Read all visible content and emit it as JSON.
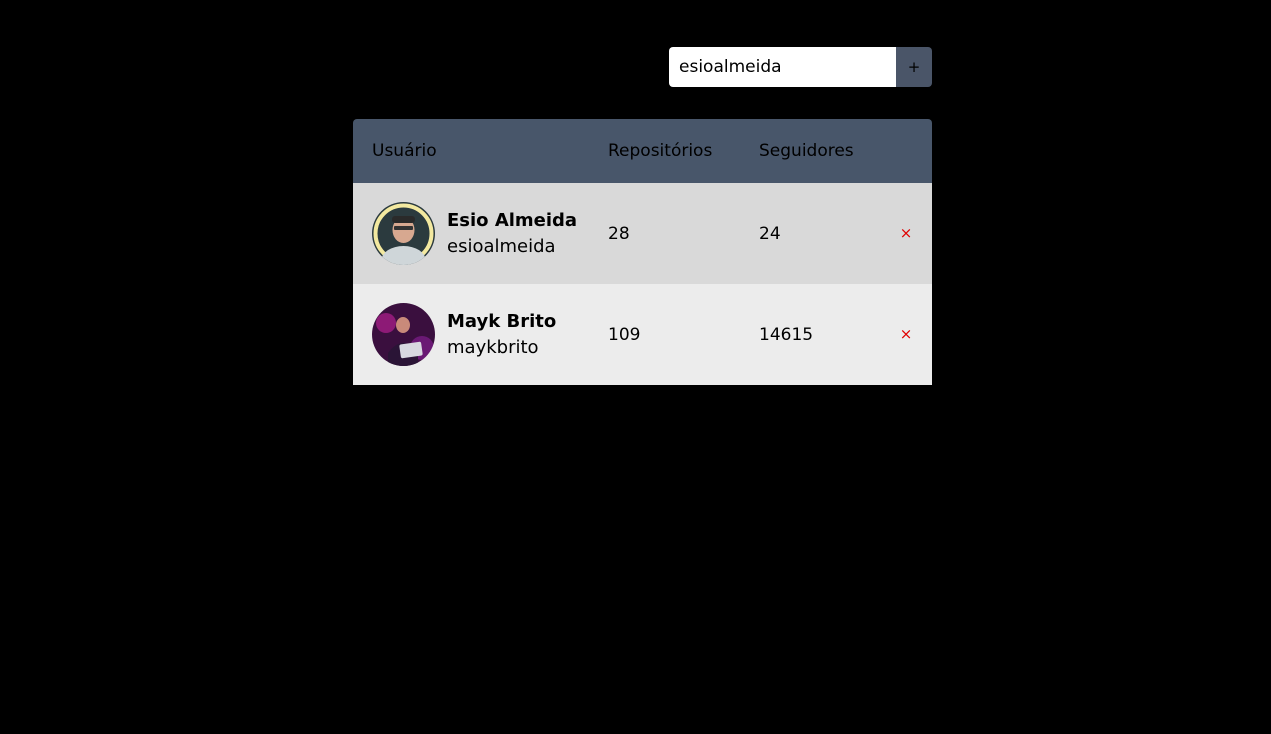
{
  "search": {
    "value": "esioalmeida",
    "add_label": "+"
  },
  "table": {
    "headers": {
      "user": "Usuário",
      "repos": "Repositórios",
      "followers": "Seguidores"
    },
    "rows": [
      {
        "name": "Esio Almeida",
        "login": "esioalmeida",
        "repositories": "28",
        "followers": "24",
        "remove_label": "×",
        "avatar_icon": "user-photo-icon"
      },
      {
        "name": "Mayk Brito",
        "login": "maykbrito",
        "repositories": "109",
        "followers": "14615",
        "remove_label": "×",
        "avatar_icon": "user-photo-icon"
      }
    ]
  },
  "colors": {
    "background": "#000000",
    "header": "#48566a",
    "row_odd": "#d9d9d9",
    "row_even": "#ececec",
    "remove": "#e00000"
  }
}
